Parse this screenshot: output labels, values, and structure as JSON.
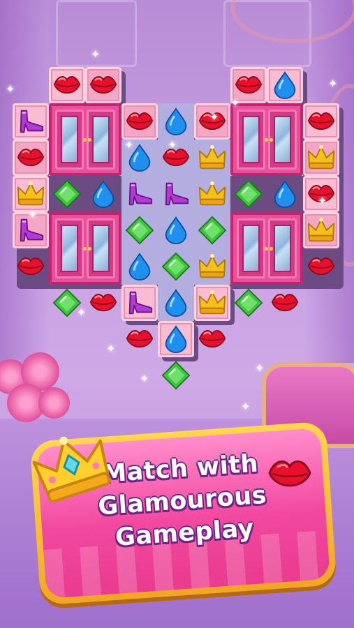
{
  "banner": {
    "line1": "Match with",
    "line2": "Glamourous",
    "line3": "Gameplay"
  },
  "pieces": [
    {
      "name": "lips-piece",
      "type": "lips"
    },
    {
      "name": "lips-piece",
      "type": "lips"
    },
    {
      "name": "lips-piece",
      "type": "lips"
    },
    {
      "name": "drop-piece",
      "type": "drop"
    },
    {
      "name": "shoe-piece",
      "type": "shoe"
    },
    {
      "name": "lips-piece",
      "type": "lips"
    },
    {
      "name": "lips-piece",
      "type": "lips"
    },
    {
      "name": "lips-piece",
      "type": "lips"
    },
    {
      "name": "lips-piece",
      "type": "lips"
    },
    {
      "name": "drop-piece",
      "type": "drop"
    },
    {
      "name": "lips-piece",
      "type": "lips"
    },
    {
      "name": "crown-piece",
      "type": "crown"
    },
    {
      "name": "crown-piece",
      "type": "crown"
    }
  ],
  "colors": {
    "lips": "#e8102c",
    "drop": "#1f8ff0",
    "shoe": "#b43ad8",
    "crown": "#f5c01a",
    "gem": "#3fc43d",
    "tile": "#f4a7c4",
    "wardrobe": "#e9509b",
    "banner_pink": "#f2489f",
    "banner_gold": "#ffd64d",
    "text_outline": "#6a2585"
  },
  "icons": [
    "lips-icon",
    "drop-icon",
    "shoe-icon",
    "crown-icon",
    "gem-icon",
    "wardrobe-icon",
    "sparkle-icon"
  ]
}
